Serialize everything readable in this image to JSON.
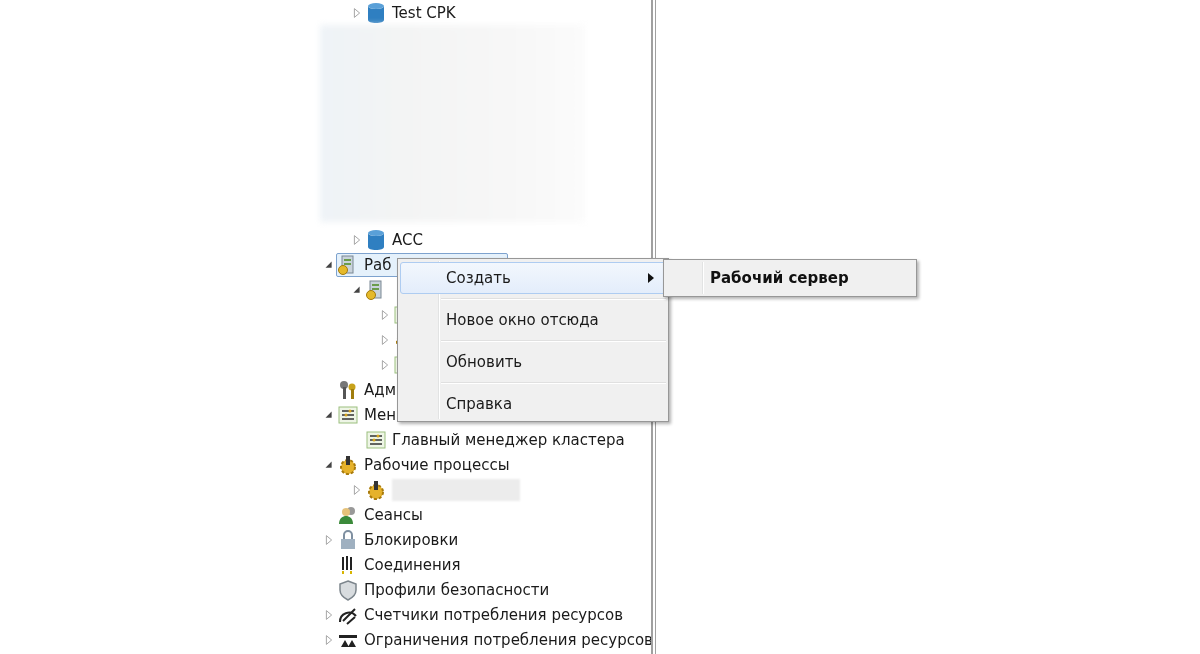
{
  "upper_items": [
    {
      "label": "Test CPK",
      "expanded": false,
      "selected": false
    },
    {
      "label": "ACC",
      "expanded": false,
      "selected": false
    }
  ],
  "tree": [
    {
      "label": "Раб",
      "expanded": true,
      "selected": true,
      "children": [
        {
          "expanded": true,
          "selected": false,
          "children": [
            {
              "expanded": false,
              "selected": false
            },
            {
              "expanded": false,
              "selected": false
            },
            {
              "expanded": false,
              "selected": false
            }
          ]
        }
      ]
    },
    {
      "label": "Адм",
      "selected": false
    },
    {
      "label": "Мен",
      "expanded": true,
      "selected": false,
      "children": [
        {
          "label": "Главный менеджер кластера",
          "selected": false
        }
      ]
    },
    {
      "label": "Рабочие процессы",
      "expanded": true,
      "selected": false,
      "children": [
        {
          "kind": "blurred",
          "expanded": false,
          "selected": false
        }
      ]
    },
    {
      "label": "Сеансы",
      "selected": false
    },
    {
      "label": "Блокировки",
      "expanded": false,
      "selected": false
    },
    {
      "label": "Соединения",
      "selected": false
    },
    {
      "label": "Профили безопасности",
      "selected": false
    },
    {
      "label": "Счетчики потребления ресурсов",
      "expanded": false,
      "selected": false
    },
    {
      "label": "Ограничения потребления ресурсов",
      "expanded": false,
      "selected": false
    }
  ],
  "context_menu": {
    "items": [
      {
        "label": "Создать",
        "selected": true,
        "submenu": true
      },
      {
        "label": "Новое окно отсюда",
        "selected": false,
        "submenu": false
      },
      {
        "label": "Обновить",
        "selected": false,
        "submenu": false
      },
      {
        "label": "Справка",
        "selected": false,
        "submenu": false
      }
    ],
    "submenu": {
      "items": [
        {
          "label": "Рабочий сервер",
          "selected": false
        }
      ]
    }
  }
}
